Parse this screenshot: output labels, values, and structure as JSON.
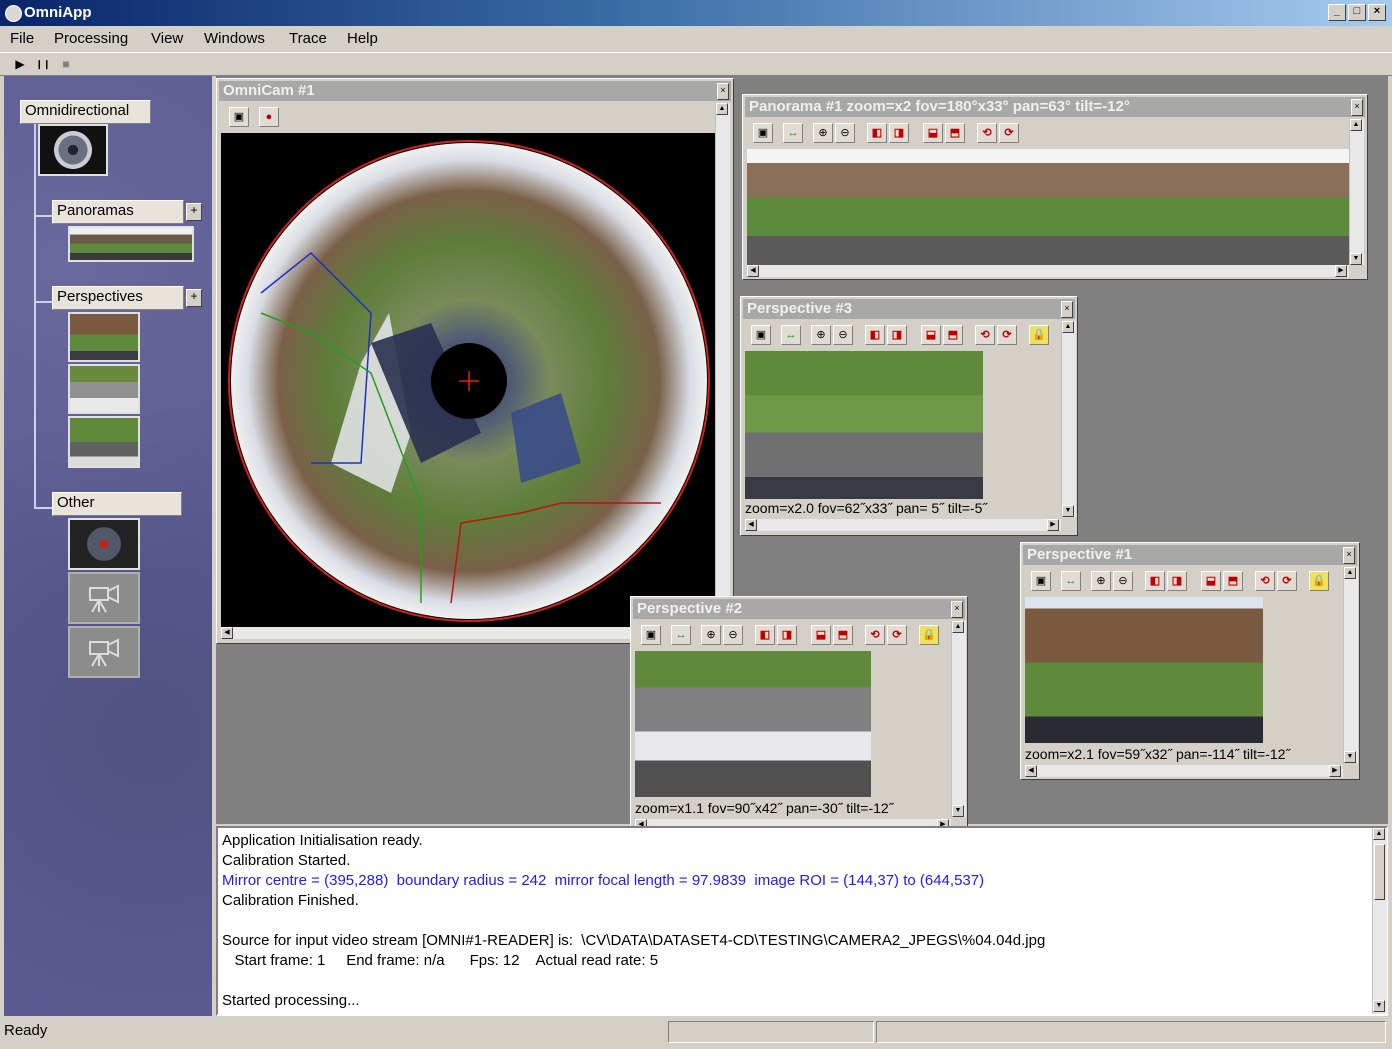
{
  "app": {
    "title": "OmniApp",
    "window_buttons": [
      "_",
      "□",
      "×"
    ]
  },
  "menu": [
    "File",
    "Processing",
    "View",
    "Windows",
    "Trace",
    "Help"
  ],
  "toolbar": {
    "play": "▶",
    "pause": "❙❙",
    "stop": "■"
  },
  "sidebar": {
    "omni": "Omnidirectional",
    "panoramas": "Panoramas",
    "perspectives": "Perspectives",
    "other": "Other",
    "plus": "+"
  },
  "windows": {
    "omnicam": {
      "title": "OmniCam #1"
    },
    "panorama": {
      "title": "Panorama #1   zoom=x2  fov=180°x33°  pan=63°  tilt=-12°"
    },
    "persp3": {
      "title": "Perspective #3",
      "readout": "zoom=x2.0  fov=62˝x33˝  pan= 5˝  tilt=-5˝"
    },
    "persp2": {
      "title": "Perspective #2",
      "readout": "zoom=x1.1  fov=90˝x42˝  pan=-30˝  tilt=-12˝"
    },
    "persp1": {
      "title": "Perspective #1",
      "readout": "zoom=x2.1  fov=59˝x32˝  pan=-114˝  tilt=-12˝"
    }
  },
  "log": {
    "lines": [
      "Application Initialisation ready.",
      "Calibration Started.",
      "Mirror centre = (395,288)  boundary radius = 242  mirror focal length = 97.9839  image ROI = (144,37) to (644,537)",
      "Calibration Finished.",
      "",
      "Source for input video stream [OMNI#1-READER] is:  \\CV\\DATA\\DATASET4-CD\\TESTING\\CAMERA2_JPEGS\\%04.04d.jpg",
      "   Start frame: 1     End frame: n/a      Fps: 12    Actual read rate: 5",
      "",
      "Started processing...",
      "...................................................."
    ],
    "highlight_color": "#1c1cf0"
  },
  "status": {
    "text": "Ready"
  }
}
